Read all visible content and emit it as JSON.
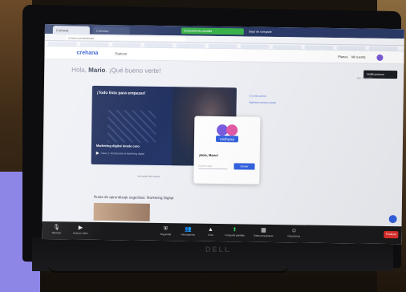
{
  "browser": {
    "tabs": [
      "Crehana",
      "Crehana"
    ],
    "sharing_banner": "Compartiendo pantalla",
    "stop_label": "Dejar de compartir",
    "url": "crehana.com/dashboard"
  },
  "site": {
    "logo": "crehana",
    "nav_explore": "Explorar",
    "nav_right_1": "Planes",
    "nav_right_2": "Mi cuenta",
    "tooltip": "Notificaciones"
  },
  "greeting": {
    "hello": "Hola,",
    "name": "Mario",
    "rest": ". ¡Qué bueno verte!",
    "right_link": "Ver mi perfil"
  },
  "hero": {
    "title": "¡Todo listo para empezar!",
    "course": "Marketing digital desde cero",
    "meta": "Clase 1: Introducción al Marketing digital"
  },
  "right_links": [
    "Ir a mis cursos",
    "Explorar nuevos cursos"
  ],
  "popup": {
    "brand": "crehana",
    "question": "¡Hola, Mario!",
    "input_placeholder": "Escribe aquí",
    "button": "Enviar"
  },
  "small_link": "Ver todos mis cursos",
  "section_title": "Rutas de aprendizaje sugeridas: Marketing Digital",
  "zoom_toolbar": {
    "items": [
      {
        "icon": "microphone-icon",
        "label": "Silenciar"
      },
      {
        "icon": "video-icon",
        "label": "Detener video"
      },
      {
        "icon": "shield-icon",
        "label": "Seguridad"
      },
      {
        "icon": "participants-icon",
        "label": "Participantes"
      },
      {
        "icon": "chat-icon",
        "label": "Chat"
      },
      {
        "icon": "share-screen-icon",
        "label": "Compartir pantalla"
      },
      {
        "icon": "breakout-icon",
        "label": "Salas para grupos"
      },
      {
        "icon": "reactions-icon",
        "label": "Reacciones"
      }
    ],
    "end": "Finalizar"
  },
  "laptop_brand": "DELL",
  "colors": {
    "accent_blue": "#3462e0",
    "hero_navy": "#1d2b57",
    "share_green": "#3ab14b",
    "end_red": "#e0302b",
    "desk_paper": "#8d86e6"
  }
}
